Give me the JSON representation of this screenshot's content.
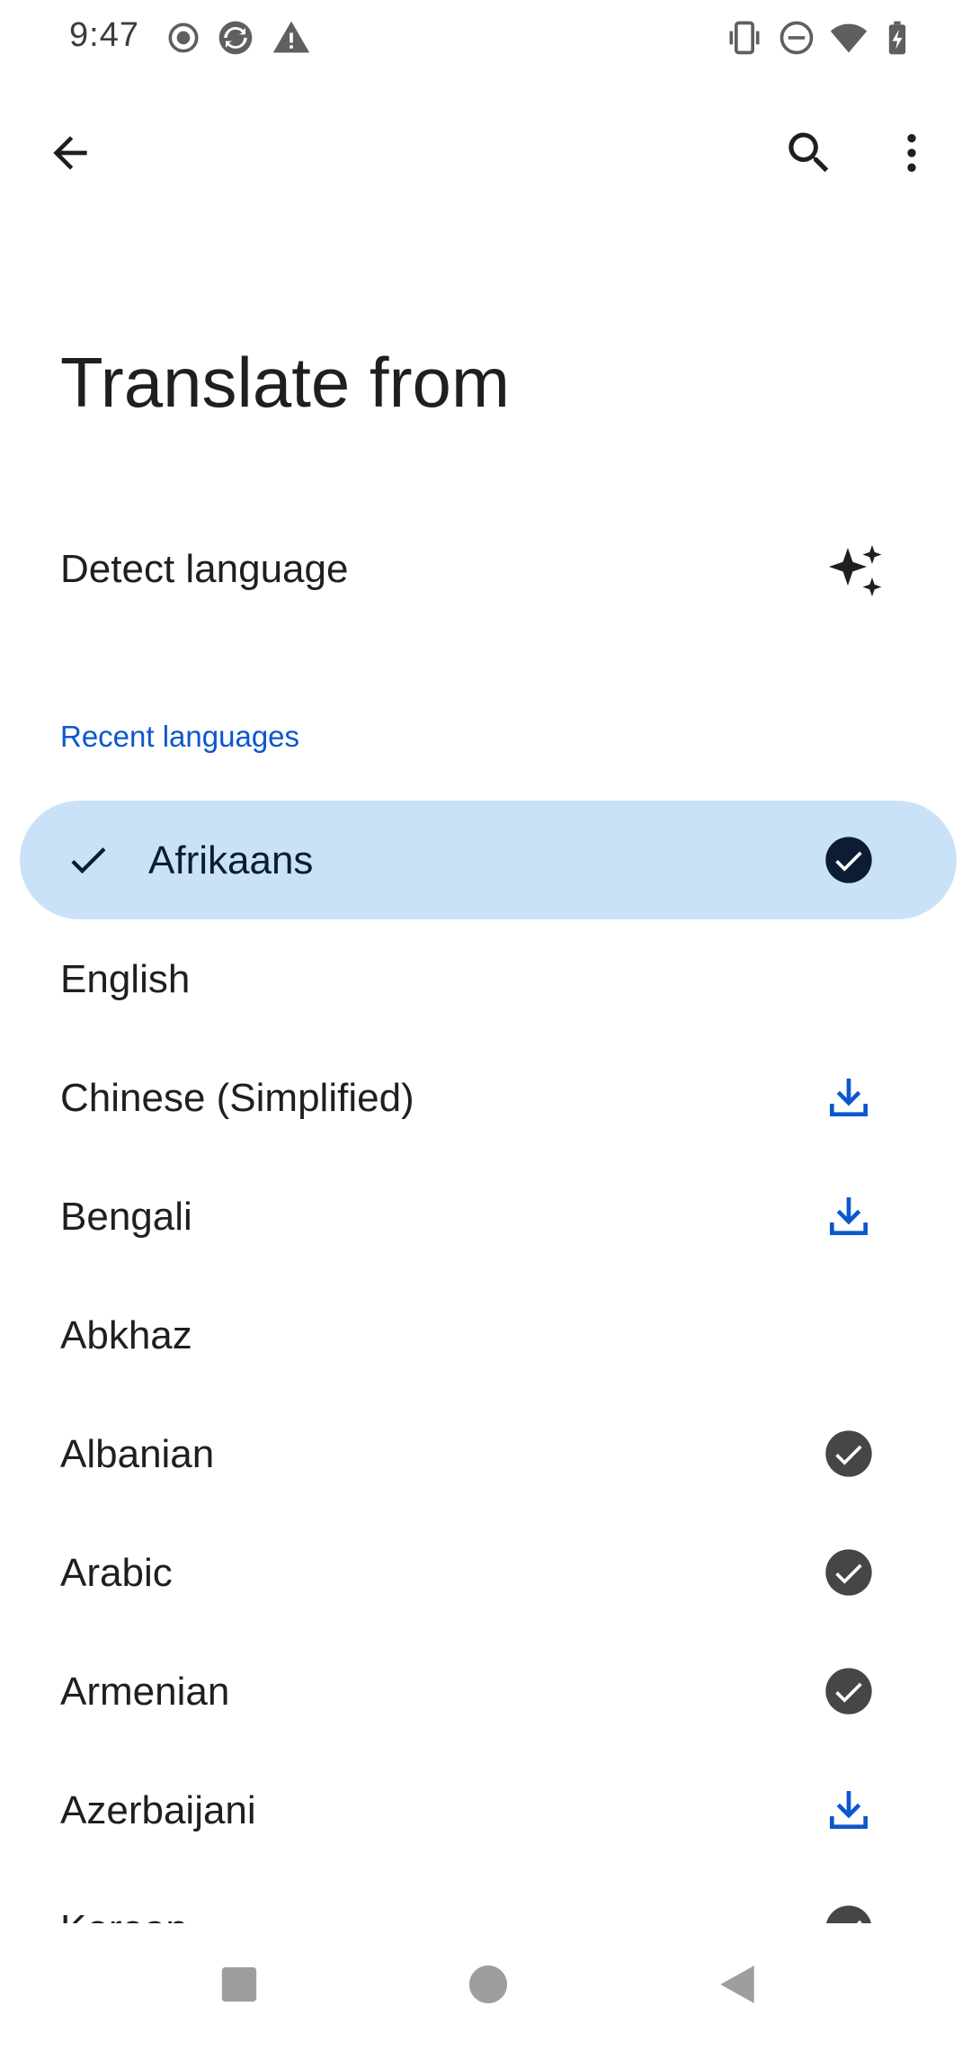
{
  "status_bar": {
    "time": "9:47",
    "left_icons": [
      "record-icon",
      "sync-icon",
      "warning-icon"
    ],
    "right_icons": [
      "vibrate-icon",
      "do-not-disturb-icon",
      "wifi-icon",
      "battery-charging-icon"
    ]
  },
  "app_bar": {
    "back_icon": "arrow-back-icon",
    "search_icon": "search-icon",
    "more_icon": "more-vert-icon"
  },
  "title": "Translate from",
  "detect": {
    "label": "Detect language",
    "icon": "sparkle-icon"
  },
  "recent_header": "Recent languages",
  "languages": [
    {
      "label": "Afrikaans",
      "status": "downloaded",
      "selected": true
    },
    {
      "label": "English",
      "status": "none",
      "selected": false
    },
    {
      "label": "Chinese (Simplified)",
      "status": "download",
      "selected": false
    },
    {
      "label": "Bengali",
      "status": "download",
      "selected": false
    },
    {
      "label": "Abkhaz",
      "status": "none",
      "selected": false
    },
    {
      "label": "Albanian",
      "status": "downloaded",
      "selected": false
    },
    {
      "label": "Arabic",
      "status": "downloaded",
      "selected": false
    },
    {
      "label": "Armenian",
      "status": "downloaded",
      "selected": false
    },
    {
      "label": "Azerbaijani",
      "status": "download",
      "selected": false
    },
    {
      "label": "Korean",
      "status": "downloaded",
      "selected": false
    }
  ],
  "colors": {
    "accent": "#0b57d0",
    "selected_bg": "#c9e2f8",
    "selected_check": "#0b1c33",
    "downloaded_check": "#444746"
  },
  "nav_bar": {
    "recents_icon": "square-recents-icon",
    "home_icon": "circle-home-icon",
    "back_icon": "triangle-back-icon"
  }
}
